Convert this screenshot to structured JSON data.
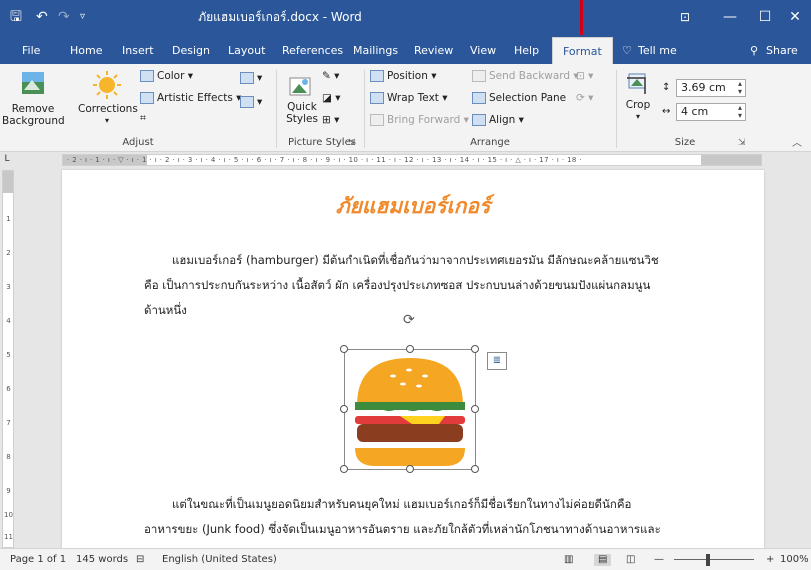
{
  "titlebar": {
    "title": "ภัยแฮมเบอร์เกอร์.docx  -  Word",
    "save_icon": "save-icon",
    "undo_icon": "undo-icon",
    "redo_icon": "redo-icon",
    "customize_icon": "chevron-down-icon",
    "ribbon_display_icon": "ribbon-display-icon",
    "minimize": "—",
    "maximize": "☐",
    "close": "✕",
    "bg_color": "#2b579a"
  },
  "tabs": [
    {
      "label": "File"
    },
    {
      "label": "Home"
    },
    {
      "label": "Insert"
    },
    {
      "label": "Design"
    },
    {
      "label": "Layout"
    },
    {
      "label": "References"
    },
    {
      "label": "Mailings"
    },
    {
      "label": "Review"
    },
    {
      "label": "View"
    },
    {
      "label": "Help"
    },
    {
      "label": "Format"
    },
    {
      "label": "Tell me"
    },
    {
      "label": "Share"
    }
  ],
  "ribbon": {
    "remove_background": "Remove Background",
    "corrections": "Corrections",
    "color": "Color",
    "artistic_effects": "Artistic Effects",
    "adjust_label": "Adjust",
    "quick_styles": "Quick Styles",
    "picture_styles_label": "Picture Styles",
    "position": "Position",
    "wrap_text": "Wrap Text",
    "bring_forward": "Bring Forward",
    "send_backward": "Send Backward",
    "selection_pane": "Selection Pane",
    "align": "Align",
    "arrange_label": "Arrange",
    "crop": "Crop",
    "height_value": "3.69 cm",
    "width_value": "4 cm",
    "size_label": "Size",
    "collapse_icon": "chevron-up-icon"
  },
  "ruler": {
    "corner": "L",
    "ticks": "· 2 · ı · 1 · ı · ▽ · ı · 1 · ı · 2 · ı · 3 · ı · 4 · ı · 5 · ı · 6 · ı · 7 · ı · 8 · ı · 9 · ı · 10 · ı · 11 · ı · 12 · ı · 13 · ı · 14 · ı · 15 · ı · △ · ı · 17 · ı · 18 ·",
    "v_numbers": [
      "1",
      "2",
      "3",
      "4",
      "5",
      "6",
      "7",
      "8",
      "9",
      "10",
      "11"
    ]
  },
  "document": {
    "title": "ภัยแฮมเบอร์เกอร์",
    "para1": [
      "แฮมเบอร์เกอร์ (hamburger) มีต้นกำเนิดที่เชื่อกันว่ามาจากประเทศเยอรมัน มีลักษณะคล้ายแซนวิช",
      "คือ เป็นการประกบกันระหว่าง เนื้อสัตว์ ผัก เครื่องปรุงประเภทซอส ประกบบนล่างด้วยขนมปังแผ่นกลมนูน",
      "ด้านหนึ่ง"
    ],
    "para2": [
      "แต่ในขณะที่เป็นเมนูยอดนิยมสำหรับคนยุคใหม่  แฮมเบอร์เกอร์ก็มีชื่อเรียกในทางไม่ค่อยดีนักคือ",
      "อาหารขยะ (Junk food) ซึ่งจัดเป็นเมนูอาหารอันตราย และภัยใกล้ตัวที่เหล่านักโภชนาทางด้านอาหารและ"
    ],
    "title_color": "#f08a2c",
    "image": "hamburger-image"
  },
  "status": {
    "page": "Page 1 of 1",
    "words": "145 words",
    "proofing_icon": "proofing-icon",
    "language": "English (United States)",
    "read_mode_icon": "read-mode-icon",
    "print_layout_icon": "print-layout-icon",
    "web_layout_icon": "web-layout-icon",
    "zoom_minus": "—",
    "zoom_plus": "+",
    "zoom": "100%"
  }
}
